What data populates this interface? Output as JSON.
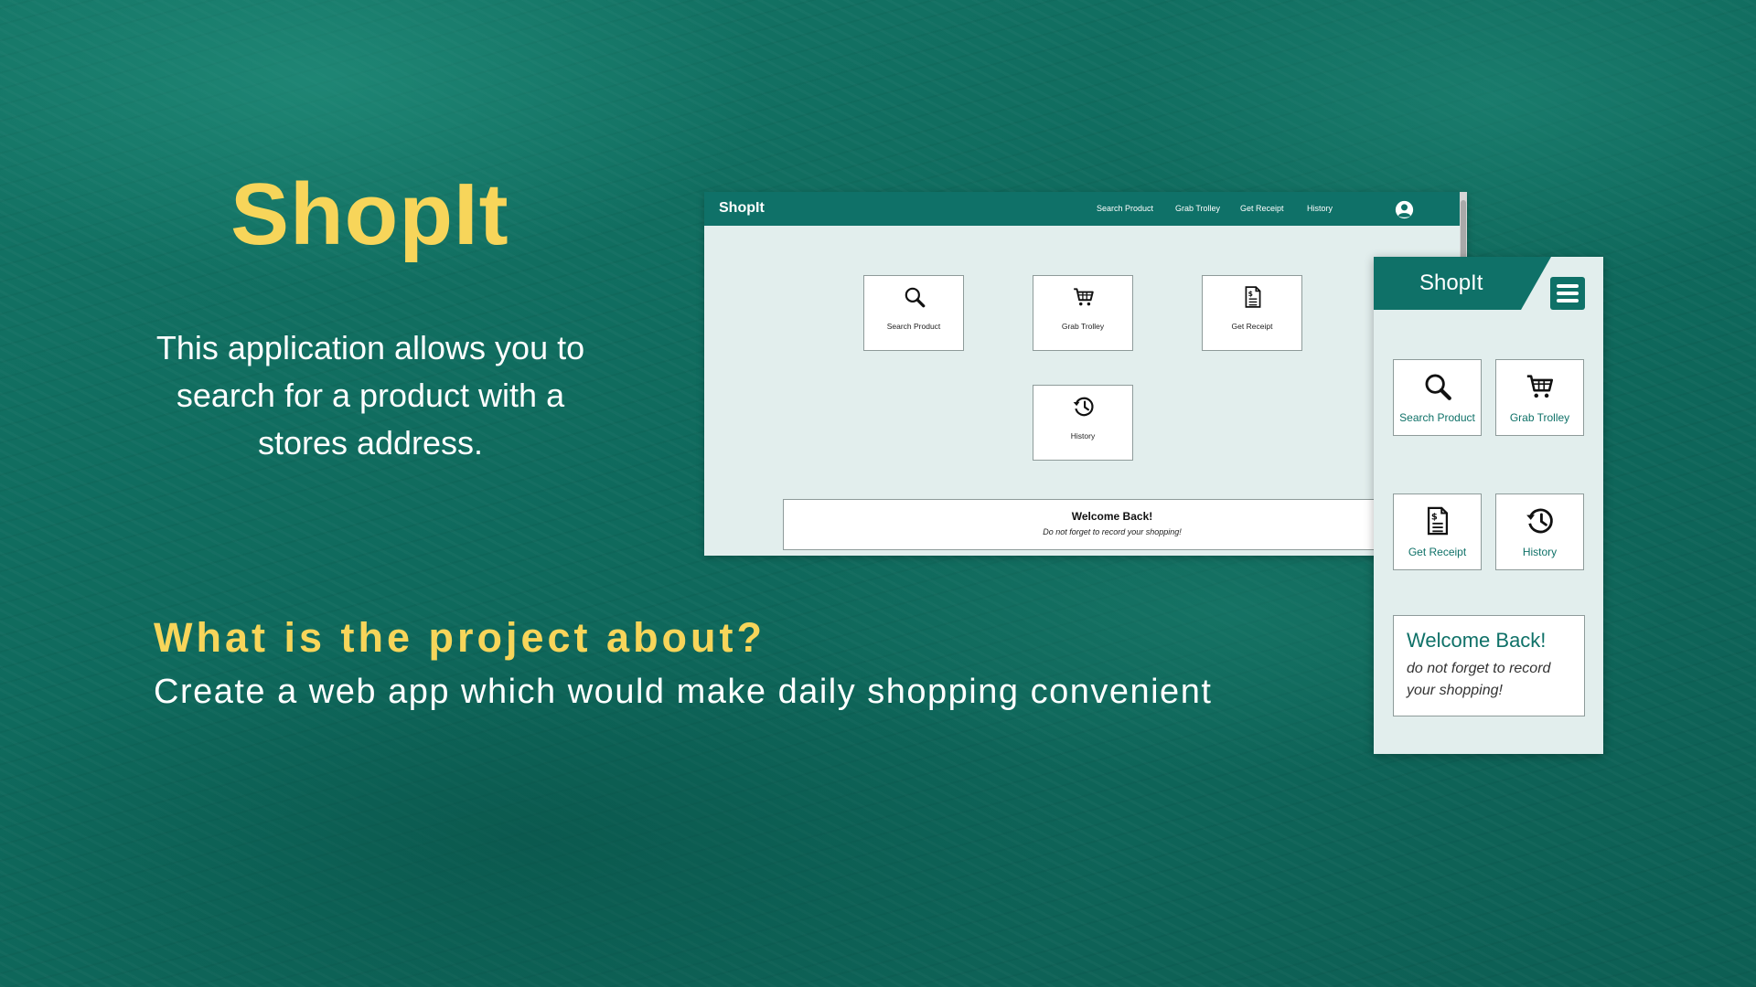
{
  "slide": {
    "title": "ShopIt",
    "description": "This application allows you to search for a product with a stores address.",
    "heading": "What is the project about?",
    "subheading": "Create a web app which would make daily shopping convenient"
  },
  "desktop": {
    "logo": "ShopIt",
    "nav": [
      "Search Product",
      "Grab Trolley",
      "Get Receipt",
      "History"
    ],
    "cards": [
      "Search Product",
      "Grab Trolley",
      "Get Receipt",
      "History"
    ],
    "welcome_title": "Welcome Back!",
    "welcome_sub": "Do not forget to record your shopping!"
  },
  "mobile": {
    "logo": "ShopIt",
    "cards": [
      "Search Product",
      "Grab Trolley",
      "Get Receipt",
      "History"
    ],
    "welcome_title": "Welcome Back!",
    "welcome_sub": "do not forget to record your shopping!"
  },
  "colors": {
    "accent": "#f7d55a",
    "brand": "#0f7168",
    "background": "#116a5d",
    "panel": "#e2eeed"
  },
  "icons": [
    "search-icon",
    "cart-icon",
    "receipt-icon",
    "history-icon",
    "user-icon",
    "hamburger-menu-icon"
  ]
}
